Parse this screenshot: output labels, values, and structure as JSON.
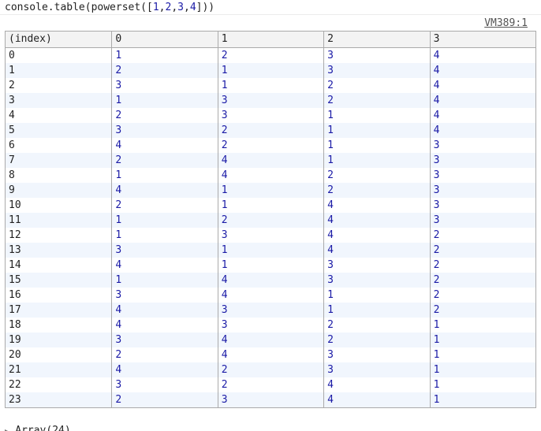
{
  "console": {
    "command_prefix": "console.table(powerset([",
    "command_args": [
      "1",
      "2",
      "3",
      "4"
    ],
    "command_suffix": "]))",
    "source_link": "VM389:1",
    "footer_summary": "Array(24)"
  },
  "table": {
    "headers": [
      "(index)",
      "0",
      "1",
      "2",
      "3"
    ],
    "rows": [
      [
        "0",
        "1",
        "2",
        "3",
        "4"
      ],
      [
        "1",
        "2",
        "1",
        "3",
        "4"
      ],
      [
        "2",
        "3",
        "1",
        "2",
        "4"
      ],
      [
        "3",
        "1",
        "3",
        "2",
        "4"
      ],
      [
        "4",
        "2",
        "3",
        "1",
        "4"
      ],
      [
        "5",
        "3",
        "2",
        "1",
        "4"
      ],
      [
        "6",
        "4",
        "2",
        "1",
        "3"
      ],
      [
        "7",
        "2",
        "4",
        "1",
        "3"
      ],
      [
        "8",
        "1",
        "4",
        "2",
        "3"
      ],
      [
        "9",
        "4",
        "1",
        "2",
        "3"
      ],
      [
        "10",
        "2",
        "1",
        "4",
        "3"
      ],
      [
        "11",
        "1",
        "2",
        "4",
        "3"
      ],
      [
        "12",
        "1",
        "3",
        "4",
        "2"
      ],
      [
        "13",
        "3",
        "1",
        "4",
        "2"
      ],
      [
        "14",
        "4",
        "1",
        "3",
        "2"
      ],
      [
        "15",
        "1",
        "4",
        "3",
        "2"
      ],
      [
        "16",
        "3",
        "4",
        "1",
        "2"
      ],
      [
        "17",
        "4",
        "3",
        "1",
        "2"
      ],
      [
        "18",
        "4",
        "3",
        "2",
        "1"
      ],
      [
        "19",
        "3",
        "4",
        "2",
        "1"
      ],
      [
        "20",
        "2",
        "4",
        "3",
        "1"
      ],
      [
        "21",
        "4",
        "2",
        "3",
        "1"
      ],
      [
        "22",
        "3",
        "2",
        "4",
        "1"
      ],
      [
        "23",
        "2",
        "3",
        "4",
        "1"
      ]
    ]
  },
  "colors": {
    "number": "#1a1aa6",
    "text": "#222222",
    "header_bg": "#f3f3f3",
    "stripe_bg": "#f1f6fd",
    "border": "#aaaaaa"
  }
}
